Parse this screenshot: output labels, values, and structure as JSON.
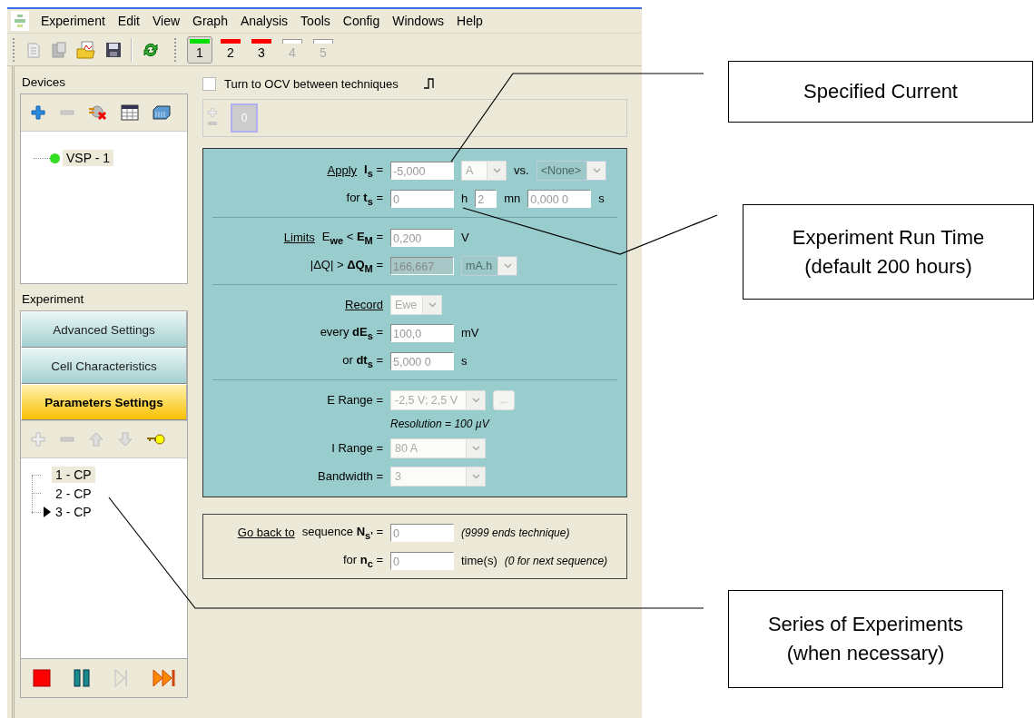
{
  "menu": [
    "Experiment",
    "Edit",
    "View",
    "Graph",
    "Analysis",
    "Tools",
    "Config",
    "Windows",
    "Help"
  ],
  "toolbar": {
    "channels": [
      {
        "label": "1",
        "color": "#00e000",
        "selected": true,
        "disabled": false
      },
      {
        "label": "2",
        "color": "#ff0000",
        "selected": false,
        "disabled": false
      },
      {
        "label": "3",
        "color": "#ff0000",
        "selected": false,
        "disabled": false
      },
      {
        "label": "4",
        "selected": false,
        "disabled": true
      },
      {
        "label": "5",
        "selected": false,
        "disabled": true
      }
    ]
  },
  "devices": {
    "title": "Devices",
    "items": [
      {
        "label": "VSP - 1",
        "color": "#33dd22",
        "selected": true
      }
    ]
  },
  "experiment": {
    "title": "Experiment",
    "sections": [
      {
        "label": "Advanced Settings",
        "selected": false
      },
      {
        "label": "Cell Characteristics",
        "selected": false
      },
      {
        "label": "Parameters Settings",
        "selected": true
      }
    ],
    "techniques": [
      {
        "label": "1 - CP",
        "selected": true,
        "running": false
      },
      {
        "label": "2 - CP",
        "selected": false,
        "running": false
      },
      {
        "label": "3 - CP",
        "selected": false,
        "running": true
      }
    ]
  },
  "technique": {
    "ocv": {
      "label": "Turn to OCV between techniques",
      "checked": false
    },
    "sequences": [
      {
        "label": "0",
        "selected": true
      }
    ],
    "sections": [
      [
        {
          "labels": [
            {
              "kind": "link",
              "text": "Apply"
            },
            {
              "kind": "label",
              "text": "**I**$_{s}$ ="
            }
          ],
          "controls": [
            {
              "kind": "field",
              "value": "-5,000",
              "disabled": false
            },
            {
              "kind": "select",
              "value": "A",
              "disabled": false
            },
            {
              "kind": "unit",
              "text": "vs."
            },
            {
              "kind": "select",
              "value": "<None>",
              "disabled": true
            }
          ]
        },
        {
          "labels": [
            {
              "kind": "label",
              "text": "for **t**$_{s}$ ="
            }
          ],
          "controls": [
            {
              "kind": "field",
              "value": "0",
              "disabled": false
            },
            {
              "kind": "unit",
              "text": "h"
            },
            {
              "kind": "short-field",
              "value": "2",
              "disabled": false
            },
            {
              "kind": "unit",
              "text": "mn"
            },
            {
              "kind": "field",
              "value": "0,000 0",
              "disabled": false
            },
            {
              "kind": "unit",
              "text": "s"
            }
          ]
        }
      ],
      [
        {
          "labels": [
            {
              "kind": "link",
              "text": "Limits"
            },
            {
              "kind": "label",
              "text": "E$_{we}$ < **E**$_{M}$ ="
            }
          ],
          "controls": [
            {
              "kind": "field",
              "value": "0,200",
              "disabled": false
            },
            {
              "kind": "unit",
              "text": "V"
            }
          ]
        },
        {
          "labels": [
            {
              "kind": "label",
              "text": "|ΔQ| > **ΔQ**$_{M}$ ="
            }
          ],
          "controls": [
            {
              "kind": "field",
              "value": "166,667",
              "disabled": true
            },
            {
              "kind": "select",
              "value": "mA.h",
              "disabled": true
            }
          ]
        }
      ],
      [
        {
          "labels": [
            {
              "kind": "link",
              "text": "Record"
            }
          ],
          "controls": [
            {
              "kind": "select",
              "value": "Ewe",
              "disabled": false
            }
          ]
        },
        {
          "labels": [
            {
              "kind": "label",
              "text": "every **dE**$_{s}$ ="
            }
          ],
          "controls": [
            {
              "kind": "field",
              "value": "100,0",
              "disabled": false
            },
            {
              "kind": "unit",
              "text": "mV"
            }
          ]
        },
        {
          "labels": [
            {
              "kind": "label",
              "text": "or **dt**$_{s}$ ="
            }
          ],
          "controls": [
            {
              "kind": "field",
              "value": "5,000 0",
              "disabled": false
            },
            {
              "kind": "unit",
              "text": "s"
            }
          ]
        }
      ],
      [
        {
          "labels": [
            {
              "kind": "label",
              "text": "E Range ="
            }
          ],
          "controls": [
            {
              "kind": "wide-select",
              "value": "-2,5 V; 2,5 V",
              "disabled": false
            },
            {
              "kind": "button",
              "text": "..."
            }
          ]
        },
        {
          "controls": [
            {
              "kind": "note",
              "text": "Resolution = 100 µV"
            }
          ]
        },
        {
          "labels": [
            {
              "kind": "label",
              "text": "I Range ="
            }
          ],
          "controls": [
            {
              "kind": "wide-select",
              "value": "80 A",
              "disabled": false
            }
          ]
        },
        {
          "labels": [
            {
              "kind": "label",
              "text": "Bandwidth ="
            }
          ],
          "controls": [
            {
              "kind": "wide-select",
              "value": "3",
              "disabled": false
            }
          ]
        }
      ]
    ],
    "loop": [
      {
        "labels": [
          {
            "kind": "link",
            "text": "Go back to"
          },
          {
            "kind": "label",
            "text": "sequence **N**$_{s'}$ ="
          }
        ],
        "controls": [
          {
            "kind": "field",
            "value": "0",
            "disabled": false
          },
          {
            "kind": "note",
            "text": "(9999 ends technique)"
          }
        ]
      },
      {
        "labels": [
          {
            "kind": "label",
            "text": "for **n**$_{c}$ ="
          }
        ],
        "controls": [
          {
            "kind": "field",
            "value": "0",
            "disabled": false
          },
          {
            "kind": "unit",
            "text": "time(s)"
          },
          {
            "kind": "note",
            "text": "(0 for next sequence)"
          }
        ]
      }
    ]
  },
  "callouts": [
    {
      "text": "Specified Current"
    },
    {
      "text": "Experiment Run Time\n(default 200 hours)"
    },
    {
      "text": "Series of Experiments\n(when necessary)"
    }
  ]
}
